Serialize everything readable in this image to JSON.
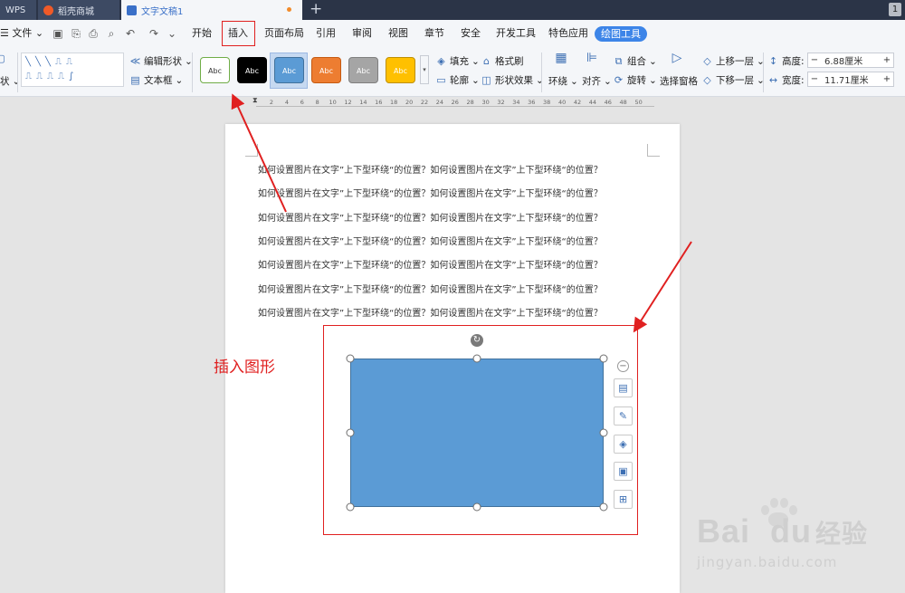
{
  "tabs": {
    "wps": "WPS",
    "store": "稻壳商城",
    "doc": "文字文稿1",
    "new": "+",
    "badge": "1"
  },
  "menu": {
    "file": "文件",
    "items": [
      "开始",
      "插入",
      "页面布局",
      "引用",
      "审阅",
      "视图",
      "章节",
      "安全",
      "开发工具",
      "特色应用"
    ],
    "drawing_tools": "绘图工具"
  },
  "ribbon": {
    "shape_label": "状",
    "edit_shape": "编辑形状",
    "text_box": "文本框",
    "styles": [
      {
        "label": "Abc",
        "bg": "#ffffff",
        "border": "#70ad47",
        "fg": "#333333"
      },
      {
        "label": "Abc",
        "bg": "#000000",
        "border": "#000000",
        "fg": "#ffffff"
      },
      {
        "label": "Abc",
        "bg": "#5b9bd5",
        "border": "#41719c",
        "fg": "#ffffff"
      },
      {
        "label": "Abc",
        "bg": "#ed7d31",
        "border": "#c55a11",
        "fg": "#ffffff"
      },
      {
        "label": "Abc",
        "bg": "#a5a5a5",
        "border": "#7f7f7f",
        "fg": "#ffffff"
      },
      {
        "label": "Abc",
        "bg": "#ffc000",
        "border": "#bf9000",
        "fg": "#ffffff"
      }
    ],
    "fill": "填充",
    "format_painter": "格式刷",
    "outline": "轮廓",
    "shape_effects": "形状效果",
    "wrap": "环绕",
    "align": "对齐",
    "group": "组合",
    "rotate": "旋转",
    "selection_pane": "选择窗格",
    "bring_forward": "上移一层",
    "send_backward": "下移一层",
    "height_label": "高度:",
    "height_value": "6.88厘米",
    "width_label": "宽度:",
    "width_value": "11.71厘米"
  },
  "ruler": {
    "ticks": [
      "2",
      "4",
      "6",
      "8",
      "10",
      "12",
      "14",
      "16",
      "18",
      "20",
      "22",
      "24",
      "26",
      "28",
      "30",
      "32",
      "34",
      "36",
      "38",
      "40",
      "42",
      "44",
      "46",
      "48",
      "50"
    ]
  },
  "document": {
    "lines": [
      "如何设置图片在文字”上下型环绕“的位置？如何设置图片在文字”上下型环绕“的位置？",
      "如何设置图片在文字”上下型环绕“的位置？如何设置图片在文字”上下型环绕“的位置？",
      "如何设置图片在文字”上下型环绕“的位置？如何设置图片在文字”上下型环绕“的位置？",
      "如何设置图片在文字”上下型环绕“的位置？如何设置图片在文字”上下型环绕“的位置？",
      "如何设置图片在文字”上下型环绕“的位置？如何设置图片在文字”上下型环绕“的位置？",
      "如何设置图片在文字”上下型环绕“的位置？如何设置图片在文字”上下型环绕“的位置？",
      "如何设置图片在文字”上下型环绕“的位置？如何设置图片在文字”上下型环绕“的位置？"
    ]
  },
  "shape": {
    "fill": "#5b9bd5"
  },
  "annotation": {
    "text": "插入图形",
    "color": "#e02020"
  },
  "watermark": {
    "brand": "Bai",
    "brand2": "du",
    "cn": "经验",
    "url": "jingyan.baidu.com"
  }
}
